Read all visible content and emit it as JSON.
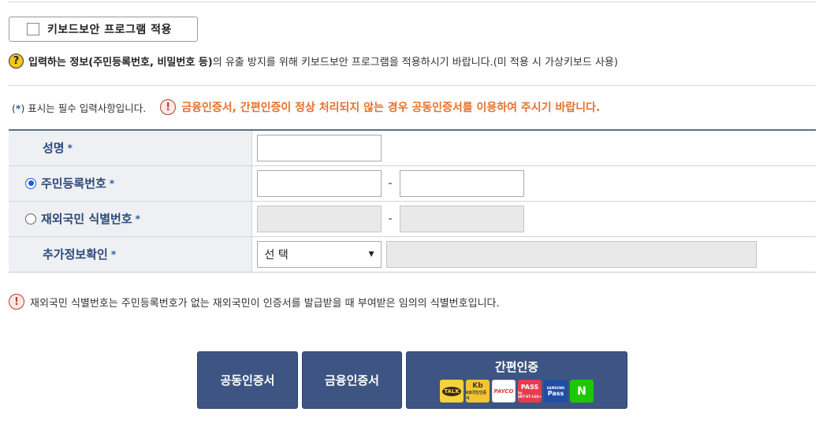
{
  "keyboard_security": {
    "label": "키보드보안 프로그램 적용",
    "checked": false
  },
  "info_notice": {
    "icon": "?",
    "bold_text": "입력하는 정보(주민등록번호, 비밀번호 등)",
    "rest_text": "의 유출 방지를 위해 키보드보안 프로그램을 적용하시기 바랍니다.(미 적용 시 가상키보드 사용)"
  },
  "required_note": {
    "open": "(",
    "star": "*",
    "close": ") 표시는 필수 입력사항입니다."
  },
  "warning": {
    "icon": "!",
    "text": "금융인증서, 간편인증이 정상 처리되지 않는 경우 공동인증서를 이용하여 주시기 바랍니다."
  },
  "form": {
    "name": {
      "label": "성명",
      "star": "*",
      "value": ""
    },
    "resident_number": {
      "label": "주민등록번호",
      "star": "*",
      "selected": true,
      "front": "",
      "back": "",
      "separator": "-"
    },
    "overseas_id": {
      "label": "재외국민 식별번호",
      "star": "*",
      "selected": false,
      "front": "",
      "back": "",
      "separator": "-"
    },
    "extra_info": {
      "label": "추가정보확인",
      "star": "*",
      "selected_option": "선 택",
      "value": ""
    }
  },
  "footer_note": {
    "icon": "!",
    "text": "재외국민 식별번호는 주민등록번호가 없는 재외국민이 인증서를 발급받을 때 부여받은 임의의 식별번호입니다."
  },
  "buttons": {
    "public_cert": "공동인증서",
    "finance_cert": "금융인증서",
    "simple_auth": "간편인증"
  },
  "simple_auth_providers": [
    {
      "name": "kakao-talk-icon",
      "text": "TALK"
    },
    {
      "name": "kb-icon",
      "text": "Kb",
      "sub": "KB국민인증서"
    },
    {
      "name": "payco-icon",
      "text": "PAYCO"
    },
    {
      "name": "pass-icon",
      "text": "PASS",
      "sub": "by SKT·KT·LGU+"
    },
    {
      "name": "samsung-pass-icon",
      "text": "Pass",
      "sub": "SAMSUNG"
    },
    {
      "name": "naver-icon",
      "text": "N"
    }
  ],
  "colors": {
    "button_bg": "#3e5583",
    "label_text": "#2c4a7a",
    "warning_text": "#e8702a",
    "radio_selected": "#1a5fd6"
  }
}
